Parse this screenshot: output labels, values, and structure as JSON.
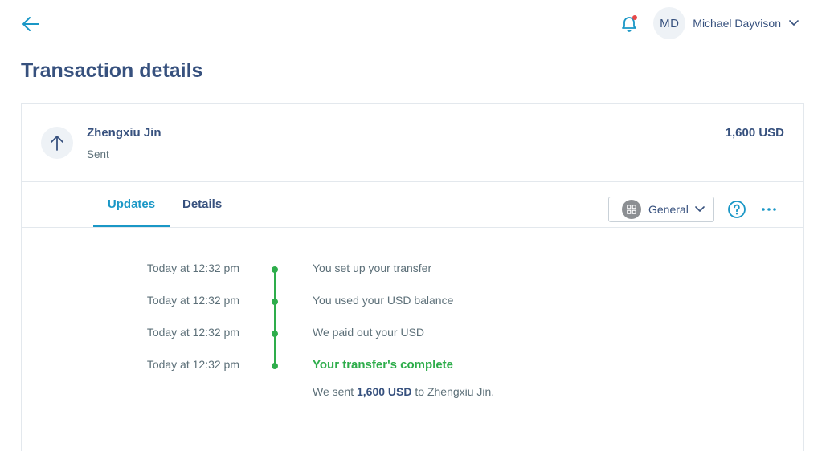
{
  "header": {
    "user": {
      "initials": "MD",
      "name": "Michael Dayvison"
    }
  },
  "page": {
    "title": "Transaction details"
  },
  "transaction": {
    "recipient": "Zhengxiu Jin",
    "status": "Sent",
    "amount": "1,600 USD"
  },
  "tabs": {
    "updates": "Updates",
    "details": "Details"
  },
  "category": {
    "selected": "General"
  },
  "timeline": [
    {
      "time": "Today at 12:32 pm",
      "text": "You set up your transfer"
    },
    {
      "time": "Today at 12:32 pm",
      "text": "You used your USD balance"
    },
    {
      "time": "Today at 12:32 pm",
      "text": "We paid out your USD"
    },
    {
      "time": "Today at 12:32 pm",
      "text": "Your transfer's complete"
    }
  ],
  "completion_note": {
    "prefix": "We sent",
    "amount": "1,600 USD",
    "middle": "to",
    "recipient": "Zhengxiu Jin."
  },
  "colors": {
    "accent": "#1a97c6",
    "success": "#2ead4b",
    "heading": "#37517e",
    "notification_dot": "#e74848"
  },
  "icons": {
    "back": "arrow-left-icon",
    "notifications": "bell-icon",
    "user_menu": "chevron-down-icon",
    "direction": "arrow-up-icon",
    "category": "grid-icon",
    "help": "question-circle-icon",
    "more": "more-dots-icon"
  }
}
